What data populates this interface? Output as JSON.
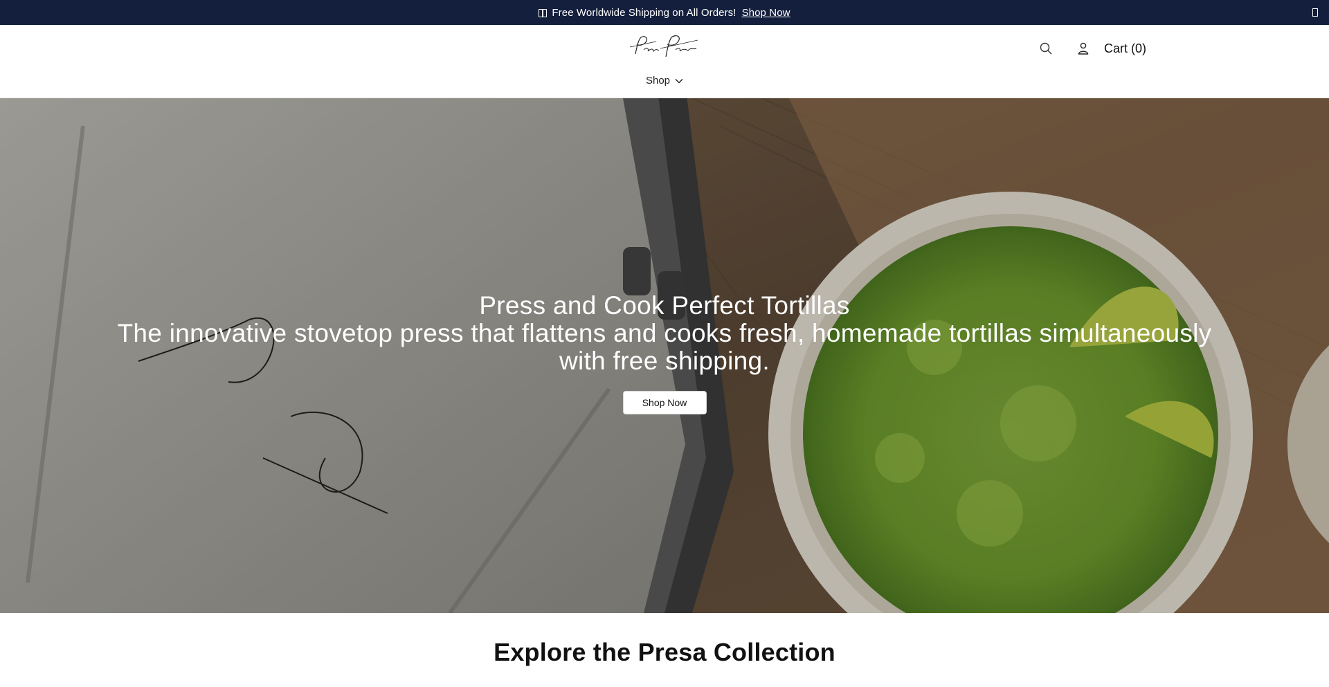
{
  "announcement": {
    "text": "Free Worldwide Shipping on All Orders!",
    "link_label": "Shop Now",
    "icon": "gift-icon"
  },
  "header": {
    "logo_text": "Presa Pan",
    "cart_label": "Cart (0)",
    "icons": [
      "search-icon",
      "user-icon"
    ]
  },
  "nav": {
    "shop_label": "Shop",
    "shop_icon": "chevron-down-icon"
  },
  "hero": {
    "title": "Press and Cook Perfect Tortillas",
    "subtitle": "The innovative stovetop press that flattens and cooks fresh, homemade tortillas simultaneously with free shipping.",
    "button_label": "Shop Now",
    "press_engraving": "Presa Pan"
  },
  "collection": {
    "heading": "Explore the Presa Collection"
  },
  "colors": {
    "announcement_bg": "#141f3d",
    "text": "#111111",
    "button_bg": "#ffffff"
  }
}
